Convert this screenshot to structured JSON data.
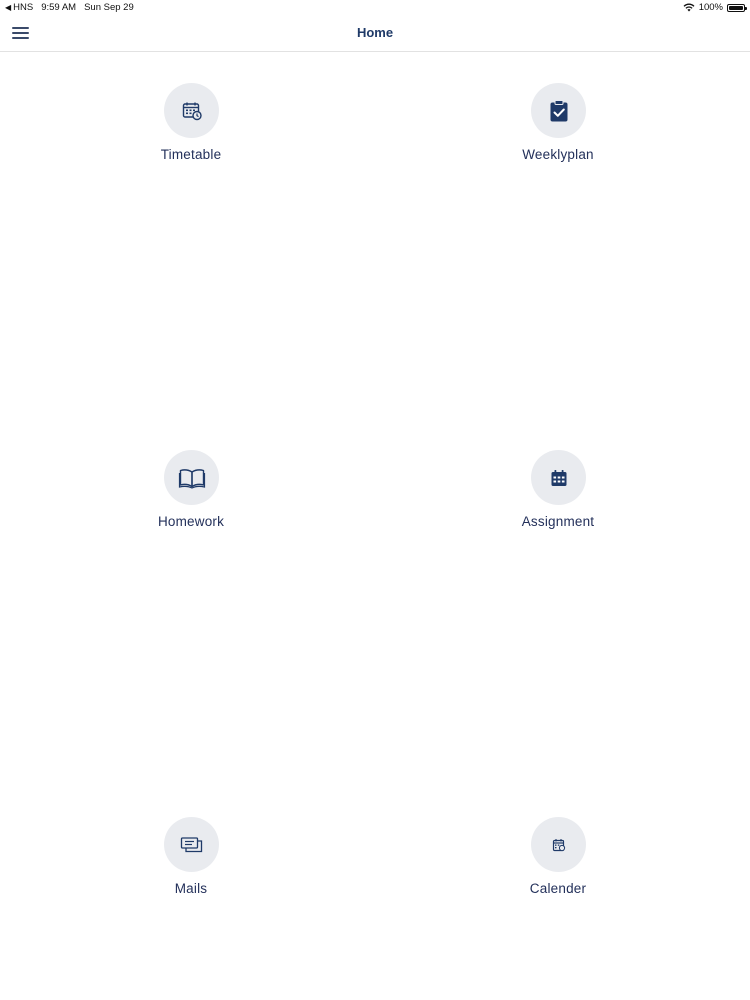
{
  "status_bar": {
    "carrier": "HNS",
    "time": "9:59 AM",
    "date": "Sun Sep 29",
    "battery": "100%",
    "battery_level": 1.0
  },
  "nav": {
    "title": "Home",
    "menu_icon": "hamburger-menu-icon"
  },
  "tiles": [
    {
      "label": "Timetable",
      "icon": "calendar-clock-icon"
    },
    {
      "label": "Weeklyplan",
      "icon": "clipboard-check-icon"
    },
    {
      "label": "Homework",
      "icon": "open-book-icon"
    },
    {
      "label": "Assignment",
      "icon": "calendar-grid-icon"
    },
    {
      "label": "Mails",
      "icon": "message-icon"
    },
    {
      "label": "Calender",
      "icon": "calendar-small-icon"
    }
  ],
  "colors": {
    "accent": "#1f3a68",
    "icon_circle": "#e9ebef",
    "label": "#23305a"
  }
}
